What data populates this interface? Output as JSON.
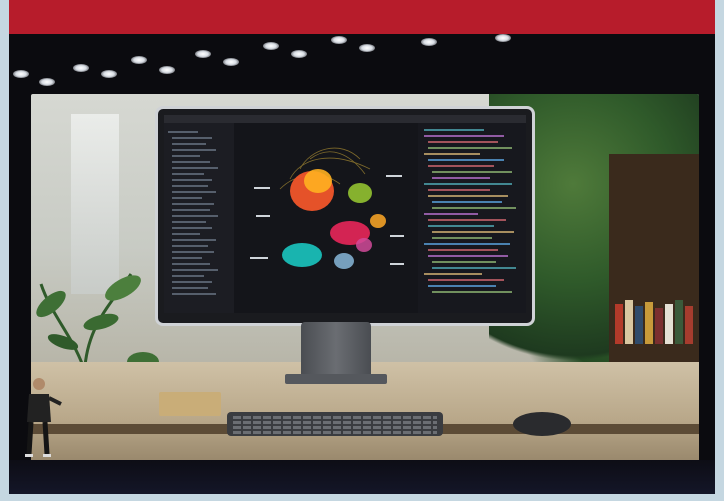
{
  "scene": {
    "description_icons": [
      "stage-lights-icon",
      "monitor-icon",
      "keyboard-icon",
      "mouse-icon",
      "plant-icon",
      "presenter-icon"
    ],
    "colors": {
      "banner": "#b71c2b",
      "stage": "#0b0b0f",
      "frame": "#c5d7e1"
    }
  }
}
